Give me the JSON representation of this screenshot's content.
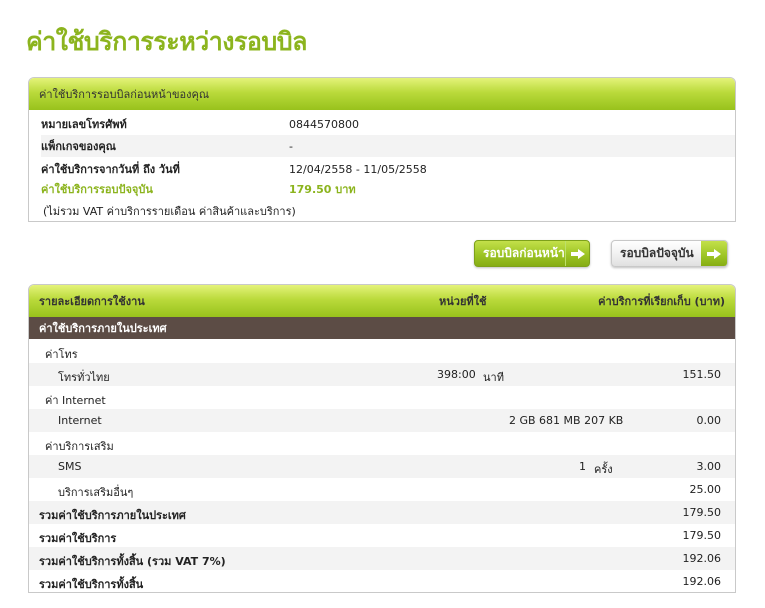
{
  "page_title": "ค่าใช้บริการระหว่างรอบบิล",
  "summary": {
    "header": "ค่าใช้บริการรอบบิลก่อนหน้าของคุณ",
    "rows": [
      {
        "label": "หมายเลขโทรศัพท์",
        "value": "0844570800"
      },
      {
        "label": "แพ็กเกจของคุณ",
        "value": "-"
      },
      {
        "label": "ค่าใช้บริการจากวันที่ ถึง วันที่",
        "value": "12/04/2558 - 11/05/2558"
      },
      {
        "label": "ค่าใช้บริการรอบปัจจุบัน",
        "value": "179.50 บาท"
      }
    ],
    "note": "(ไม่รวม VAT ค่าบริการรายเดือน ค่าสินค้าและบริการ)"
  },
  "buttons": {
    "previous_cycle": "รอบบิลก่อนหน้า",
    "current_cycle": "รอบบิลปัจจุบัน"
  },
  "usage": {
    "headers": {
      "detail": "รายละเอียดการใช้งาน",
      "unit": "หน่วยที่ใช้",
      "amount": "ค่าบริการที่เรียกเก็บ (บาท)"
    },
    "section_title": "ค่าใช้บริการภายในประเทศ",
    "rows": [
      {
        "label": "ค่าโทร",
        "qty": "",
        "unit": "",
        "amount": ""
      },
      {
        "label": "โทรทั่วไทย",
        "qty": "398:00",
        "unit": "นาที",
        "amount": "151.50"
      },
      {
        "label": "ค่า Internet",
        "qty": "",
        "unit": "",
        "amount": ""
      },
      {
        "label": "Internet",
        "qty": "2 GB 681 MB 207 KB",
        "unit": "",
        "amount": "0.00"
      },
      {
        "label": "ค่าบริการเสริม",
        "qty": "",
        "unit": "",
        "amount": ""
      },
      {
        "label": "SMS",
        "qty": "1",
        "unit": "ครั้ง",
        "amount": "3.00"
      },
      {
        "label": "บริการเสริมอื่นๆ",
        "qty": "",
        "unit": "",
        "amount": "25.00"
      },
      {
        "label": "รวมค่าใช้บริการภายในประเทศ",
        "qty": "",
        "unit": "",
        "amount": "179.50"
      },
      {
        "label": "รวมค่าใช้บริการ",
        "qty": "",
        "unit": "",
        "amount": "179.50"
      },
      {
        "label": "รวมค่าใช้บริการทั้งสิ้น (รวม VAT 7%)",
        "qty": "",
        "unit": "",
        "amount": "192.06"
      },
      {
        "label": "รวมค่าใช้บริการทั้งสิ้น",
        "qty": "",
        "unit": "",
        "amount": "192.06"
      }
    ]
  },
  "colors": {
    "accent_green": "#8cb41e",
    "section_brown": "#5c4c45"
  }
}
